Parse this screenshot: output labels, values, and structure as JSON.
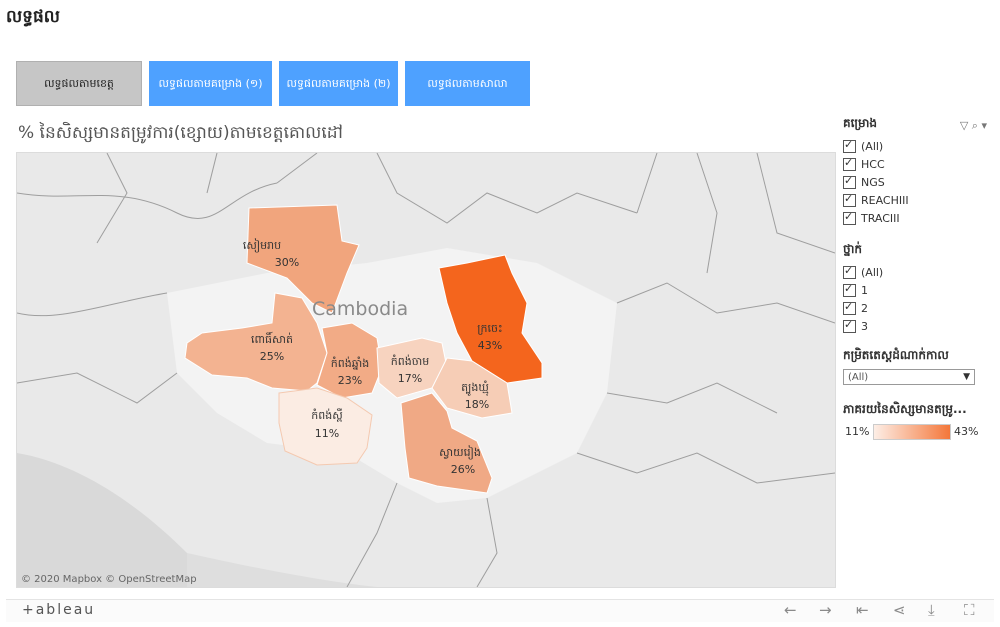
{
  "header": {
    "title": "លទ្ធផល"
  },
  "tabs": [
    {
      "label": "លទ្ធផលតាមខេត្ត",
      "active": true
    },
    {
      "label": "លទ្ធផលតាមគម្រោង (១)",
      "active": false
    },
    {
      "label": "លទ្ធផលតាមគម្រោង (២)",
      "active": false
    },
    {
      "label": "លទ្ធផលតាមសាលា",
      "active": false
    }
  ],
  "viz": {
    "title": "% នៃសិស្សមានតម្រូវការ(ខ្សោយ)តាមខេត្តគោលដៅ",
    "country_label": "Cambodia",
    "attribution": "© 2020 Mapbox © OpenStreetMap",
    "provinces": [
      {
        "name": "សៀមរាប",
        "value": "30%",
        "color": "#f1a57d"
      },
      {
        "name": "ពោធិ៍សាត់",
        "value": "25%",
        "color": "#f3b391"
      },
      {
        "name": "កំពង់ឆ្នាំង",
        "value": "23%",
        "color": "#f2ab86"
      },
      {
        "name": "កំពង់ចាម",
        "value": "17%",
        "color": "#f7d3bf"
      },
      {
        "name": "ក្រចេះ",
        "value": "43%",
        "color": "#f4651d"
      },
      {
        "name": "ត្បូងឃ្មុំ",
        "value": "18%",
        "color": "#f6cdb6"
      },
      {
        "name": "កំពង់ស្ពឺ",
        "value": "11%",
        "color": "#fbece3"
      },
      {
        "name": "ស្វាយរៀង",
        "value": "26%",
        "color": "#f0a985"
      }
    ]
  },
  "filters": {
    "project": {
      "title": "គម្រោង",
      "items": [
        "(All)",
        "HCC",
        "NGS",
        "REACHIII",
        "TRACIII"
      ]
    },
    "grade": {
      "title": "ថ្នាក់",
      "items": [
        "(All)",
        "1",
        "2",
        "3"
      ]
    },
    "period": {
      "title": "កម្រិតតេស្តដំណាក់កាល",
      "selected": "(All)"
    },
    "legend": {
      "title": "ភាគរយនៃសិស្សមានតម្រូ...",
      "min": "11%",
      "max": "43%",
      "color_low": "#fdeee6",
      "color_high": "#f4773a"
    }
  },
  "toolbar": {
    "logo": "+ableau",
    "buttons": [
      "undo-icon",
      "redo-icon",
      "revert-icon",
      "share-icon",
      "download-icon",
      "fullscreen-icon"
    ]
  }
}
